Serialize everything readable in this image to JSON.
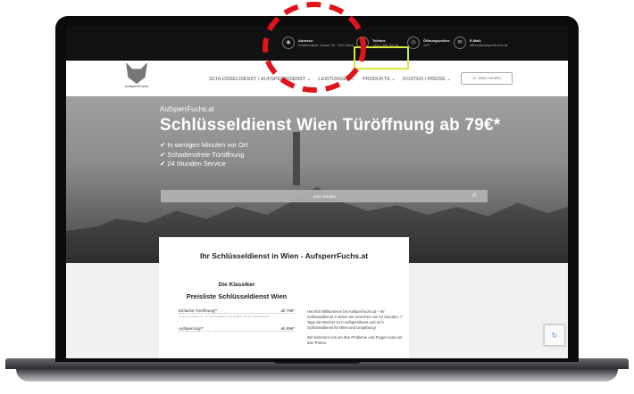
{
  "topbar": {
    "address_label": "Adresse:",
    "address_value": "Knöllerbauer Gasse 40, 1100 Wien",
    "phone_label": "Telefon:",
    "phone_value": "+43 1 361 32 16",
    "hours_label": "Öffnungszeiten:",
    "hours_value": "24/7",
    "email_label": "E-Mail:",
    "email_value": "office@aufsperrfuchs.at"
  },
  "logo": {
    "text": "AufsperrFuchs"
  },
  "nav": {
    "items": [
      "SCHLÜSSELDIENST / AUFSPERRDIENST ⌄",
      "LEISTUNGEN ⌄",
      "PRODUKTE ⌄",
      "KOSTEN / PREISE ⌄"
    ],
    "cta": "☏ Jetzt Anrufen"
  },
  "hero": {
    "subtitle": "AufsperrFuchs.at",
    "title": "Schlüsseldienst Wien Türöffnung ab 79€*",
    "bullets": [
      "In wenigen Minuten vor Ort",
      "Schadensfreie Türöffnung",
      "24 Stunden Service"
    ],
    "button": "Jetzt Anrufen",
    "button_icon": "phone-icon"
  },
  "content": {
    "title": "Ihr Schlüsseldienst in Wien - AufsperrFuchs.at",
    "klassiker": "Die Klassiker",
    "preisliste": "Preisliste Schlüsseldienst Wien",
    "prices": [
      {
        "name": "Einfache Türöffnung**",
        "price": "ab 79€*",
        "note": "** eine normalen Tür (Tür nur zugefallen) inkl. Anfahrt und 10 min Arbeitszeit"
      },
      {
        "name": "Aufsperrung**",
        "price": "ab 99€*",
        "note": ""
      }
    ],
    "welcome": "Herzlich Willkommen bei Aufsperrfuchs.at – Ihr Schlüsseldienst in Wien! Sie erreichen uns 24 Stunden, 7 Tage die Woche! 24 h Aufsperrdienst und 24 h Schlüsseldienst für Wien und Umgebung!",
    "welcome2": "Wir kümmern uns um Ihre Probleme und Fragen rund um das Thema"
  },
  "colors": {
    "highlight": "#d6e63a",
    "annotation": "#e0141a"
  }
}
